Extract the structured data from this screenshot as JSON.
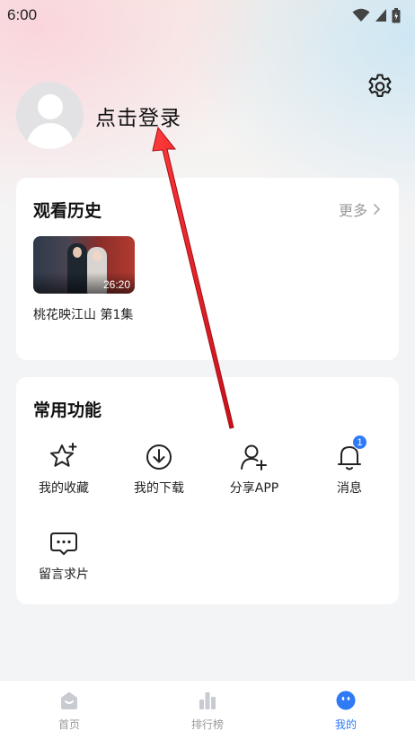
{
  "status_bar": {
    "time": "6:00"
  },
  "profile": {
    "login_label": "点击登录"
  },
  "history": {
    "title": "观看历史",
    "more_label": "更多",
    "video": {
      "duration": "26:20",
      "title": "桃花映江山 第1集"
    }
  },
  "functions": {
    "title": "常用功能",
    "items": [
      {
        "label": "我的收藏",
        "icon": "star-icon"
      },
      {
        "label": "我的下载",
        "icon": "download-icon"
      },
      {
        "label": "分享APP",
        "icon": "add-user-icon"
      },
      {
        "label": "消息",
        "icon": "bell-icon",
        "badge": "1"
      },
      {
        "label": "留言求片",
        "icon": "chat-icon"
      }
    ]
  },
  "tabbar": {
    "items": [
      {
        "label": "首页",
        "icon": "home-icon"
      },
      {
        "label": "排行榜",
        "icon": "ranking-icon"
      },
      {
        "label": "我的",
        "icon": "face-icon",
        "active": true
      }
    ]
  },
  "colors": {
    "accent": "#2f7bf5",
    "annotation_arrow": "#e8202a",
    "background": "#f3f4f6"
  }
}
